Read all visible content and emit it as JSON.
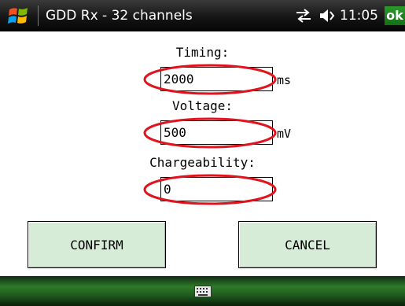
{
  "titlebar": {
    "app_title": "GDD Rx - 32 channels",
    "time": "11:05",
    "ok_label": "ok",
    "icons": [
      "windows-start-icon",
      "connectivity-icon",
      "volume-icon"
    ]
  },
  "form": {
    "timing": {
      "label": "Timing:",
      "value": "2000",
      "unit": "ms"
    },
    "voltage": {
      "label": "Voltage:",
      "value": "500",
      "unit": "mV"
    },
    "chargeability": {
      "label": "Chargeability:",
      "value": "0",
      "unit": ""
    }
  },
  "buttons": {
    "confirm": "CONFIRM",
    "cancel": "CANCEL"
  },
  "bottombar": {
    "icons": [
      "keyboard-icon"
    ]
  },
  "colors": {
    "titlebar_bg": "#111111",
    "ok_green": "#1f8a1f",
    "button_bg": "#d6ecd6",
    "highlight_ellipse": "#e0141e",
    "bottombar_green": "#2f7a2a"
  }
}
